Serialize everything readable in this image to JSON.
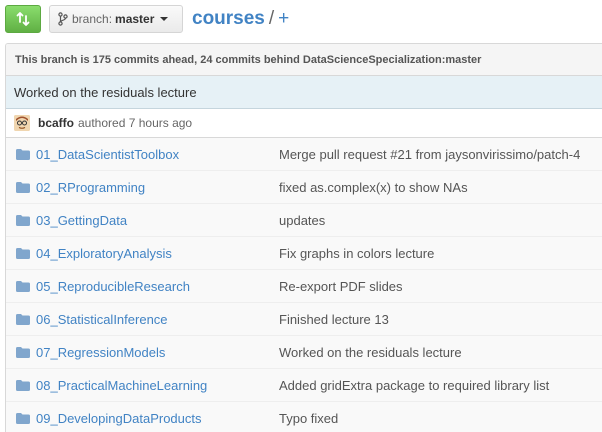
{
  "header": {
    "branch_prefix": "branch:",
    "branch_name": "master",
    "repo_name": "courses",
    "separator": "/",
    "add_label": "+"
  },
  "tease": {
    "text": "This branch is 175 commits ahead, 24 commits behind DataScienceSpecialization:master"
  },
  "last_commit": {
    "message": "Worked on the residuals lecture",
    "author": "bcaffo",
    "authored_text": "authored 7 hours ago"
  },
  "files": [
    {
      "name": "01_DataScientistToolbox",
      "message": "Merge pull request #21 from jaysonvirissimo/patch-4"
    },
    {
      "name": "02_RProgramming",
      "message": "fixed as.complex(x) to show NAs"
    },
    {
      "name": "03_GettingData",
      "message": "updates"
    },
    {
      "name": "04_ExploratoryAnalysis",
      "message": "Fix graphs in colors lecture"
    },
    {
      "name": "05_ReproducibleResearch",
      "message": "Re-export PDF slides"
    },
    {
      "name": "06_StatisticalInference",
      "message": "Finished lecture 13"
    },
    {
      "name": "07_RegressionModels",
      "message": "Worked on the residuals lecture"
    },
    {
      "name": "08_PracticalMachineLearning",
      "message": "Added gridExtra package to required library list"
    },
    {
      "name": "09_DevelopingDataProducts",
      "message": "Typo fixed"
    }
  ],
  "icons": {
    "compare": "compare-icon",
    "branch": "branch-icon",
    "folder": "folder-icon"
  },
  "colors": {
    "link": "#4183c4",
    "compare_button": "#60b044",
    "commit_bar": "#e6f1f6",
    "folder": "#80a6cd"
  }
}
